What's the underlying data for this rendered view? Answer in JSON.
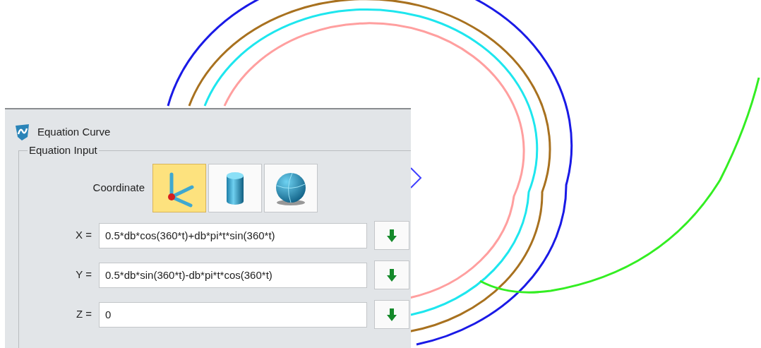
{
  "dialog": {
    "title": "Equation Curve",
    "group": {
      "legend": "Equation Input",
      "coordinate": {
        "label": "Coordinate",
        "options": [
          {
            "kind": "cartesian",
            "selected": true
          },
          {
            "kind": "cylindrical",
            "selected": false
          },
          {
            "kind": "spherical",
            "selected": false
          }
        ]
      },
      "equations": [
        {
          "label": "X =",
          "value": "0.5*db*cos(360*t)+db*pi*t*sin(360*t)"
        },
        {
          "label": "Y =",
          "value": "0.5*db*sin(360*t)-db*pi*t*cos(360*t)"
        },
        {
          "label": "Z =",
          "value": "0"
        }
      ]
    }
  }
}
